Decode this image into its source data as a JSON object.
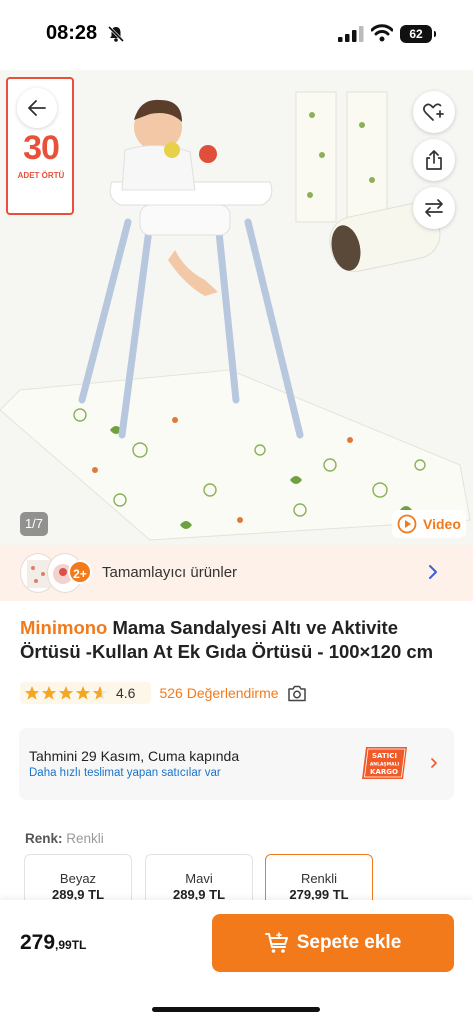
{
  "status_bar": {
    "time": "08:28",
    "battery": "62"
  },
  "gallery": {
    "promo_number": "30",
    "promo_label": "ADET ÖRTÜ",
    "counter": "1/7",
    "video_label": "Video"
  },
  "complementary": {
    "count": "2+",
    "label": "Tamamlayıcı ürünler"
  },
  "product": {
    "brand": "Minimono",
    "title_line1": " Mama Sandalyesi Altı ve Aktivite",
    "title_line2": "Örtüsü -Kullan At Ek Gıda Örtüsü - 100×120 cm"
  },
  "rating": {
    "score": "4.6",
    "stars": 4.6,
    "count_label": "526 Değerlendirme"
  },
  "delivery": {
    "estimate": "Tahmini 29 Kasım, Cuma kapında",
    "note": "Daha hızlı teslimat yapan satıcılar var",
    "badge_line1": "SATICI",
    "badge_line2": "ANLAŞMALI",
    "badge_line3": "KARGO"
  },
  "color": {
    "label": "Renk:",
    "selected": "Renkli",
    "options": [
      {
        "name": "Beyaz",
        "price": "289,9 TL"
      },
      {
        "name": "Mavi",
        "price": "289,9 TL"
      },
      {
        "name": "Renkli",
        "price": "279,99 TL"
      }
    ]
  },
  "bottom": {
    "price_main": "279",
    "price_cents": ",99TL",
    "cart_label": "Sepete ekle"
  },
  "colors": {
    "accent": "#f27a1a",
    "promo_red": "#e8503a",
    "link_blue": "#1a73c9"
  }
}
